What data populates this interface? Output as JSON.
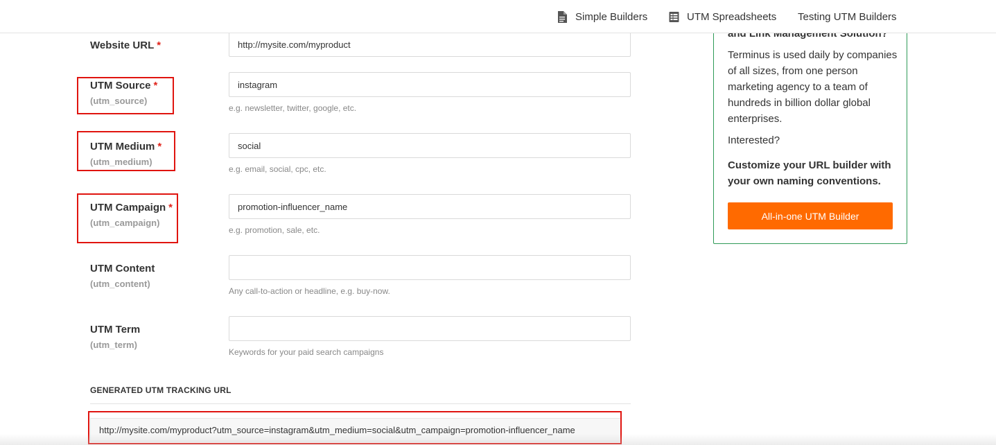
{
  "nav": {
    "items": [
      {
        "label": "Simple Builders",
        "icon": "document-icon"
      },
      {
        "label": "UTM Spreadsheets",
        "icon": "spreadsheet-icon"
      },
      {
        "label": "Testing UTM Builders",
        "icon": ""
      }
    ]
  },
  "form": {
    "required_mark": "*",
    "website": {
      "label": "Website URL",
      "value": "http://mysite.com/myproduct"
    },
    "source": {
      "label": "UTM Source",
      "param": "(utm_source)",
      "value": "instagram",
      "hint": "e.g. newsletter, twitter, google, etc."
    },
    "medium": {
      "label": "UTM Medium",
      "param": "(utm_medium)",
      "value": "social",
      "hint": "e.g. email, social, cpc, etc."
    },
    "campaign": {
      "label": "UTM Campaign",
      "param": "(utm_campaign)",
      "value": "promotion-influencer_name",
      "hint": "e.g. promotion, sale, etc."
    },
    "content": {
      "label": "UTM Content",
      "param": "(utm_content)",
      "value": "",
      "hint": "Any call-to-action or headline, e.g. buy-now."
    },
    "term": {
      "label": "UTM Term",
      "param": "(utm_term)",
      "value": "",
      "hint": "Keywords for your paid search campaigns"
    }
  },
  "generated": {
    "title": "GENERATED UTM TRACKING URL",
    "url": "http://mysite.com/myproduct?utm_source=instagram&utm_medium=social&utm_campaign=promotion-influencer_name"
  },
  "promo": {
    "heading_partial": "and Link Management Solution?",
    "body": "Terminus is used daily by companies of all sizes, from one person marketing agency to a team of hundreds in billion dollar global enterprises.",
    "interested": "Interested?",
    "cta_text": "Customize your URL builder with your own naming conventions.",
    "button_label": "All-in-one UTM Builder"
  },
  "colors": {
    "required": "#e0241b",
    "highlight_box": "#e0140f",
    "promo_border": "#2e9a57",
    "button_bg": "#ff6a00"
  }
}
